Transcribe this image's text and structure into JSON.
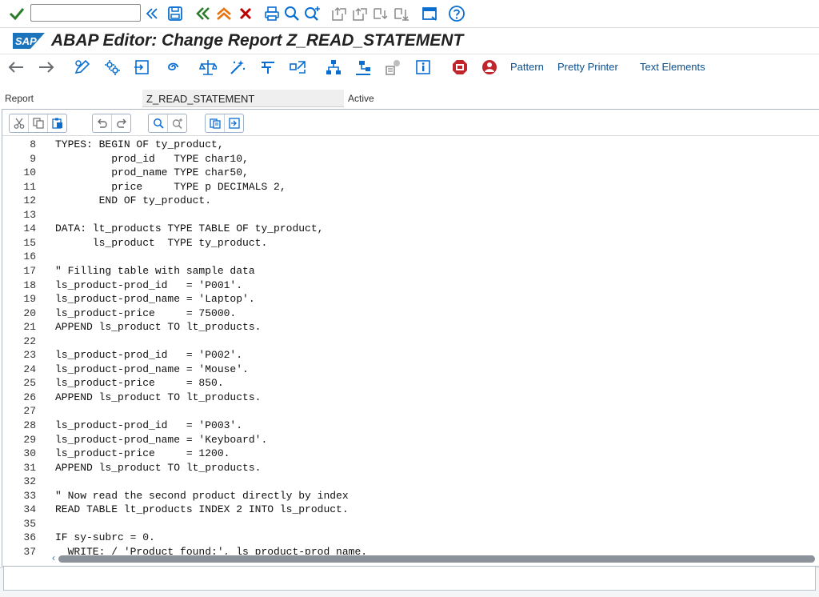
{
  "system_toolbar": {
    "command_field": {
      "value": "",
      "placeholder": ""
    },
    "icons": [
      "enter-check-icon",
      "expand-icon",
      "save-icon",
      "back-icon",
      "exit-icon",
      "cancel-icon",
      "print-icon",
      "find-icon",
      "find-next-icon",
      "first-page-icon",
      "previous-page-icon",
      "next-page-icon",
      "last-page-icon",
      "new-session-icon",
      "help-icon"
    ]
  },
  "title_bar": {
    "logo_text": "SAP",
    "title": "ABAP Editor: Change Report Z_READ_STATEMENT"
  },
  "app_toolbar": {
    "icons": [
      "back-arrow-icon",
      "forward-arrow-icon",
      "display-change-icon",
      "active-inactive-icon",
      "other-object-icon",
      "check-icon",
      "activate-icon",
      "test-icon",
      "where-used-icon",
      "navigation-icon",
      "hierarchy-icon",
      "display-object-list-icon",
      "breakpoint-icon",
      "info-icon",
      "set-breakpoint-icon",
      "stop-icon"
    ],
    "pattern_label": "Pattern",
    "pretty_printer_label": "Pretty Printer",
    "text_elements_label": "Text Elements"
  },
  "header": {
    "report_label": "Report",
    "report_name": "Z_READ_STATEMENT",
    "status": "Active"
  },
  "editor": {
    "scroll_left_glyph": "‹",
    "lines": [
      {
        "num": "8",
        "text": "TYPES: BEGIN OF ty_product,"
      },
      {
        "num": "9",
        "text": "         prod_id   TYPE char10,"
      },
      {
        "num": "10",
        "text": "         prod_name TYPE char50,"
      },
      {
        "num": "11",
        "text": "         price     TYPE p DECIMALS 2,"
      },
      {
        "num": "12",
        "text": "       END OF ty_product."
      },
      {
        "num": "13",
        "text": ""
      },
      {
        "num": "14",
        "text": "DATA: lt_products TYPE TABLE OF ty_product,"
      },
      {
        "num": "15",
        "text": "      ls_product  TYPE ty_product."
      },
      {
        "num": "16",
        "text": ""
      },
      {
        "num": "17",
        "text": "\" Filling table with sample data"
      },
      {
        "num": "18",
        "text": "ls_product-prod_id   = 'P001'."
      },
      {
        "num": "19",
        "text": "ls_product-prod_name = 'Laptop'."
      },
      {
        "num": "20",
        "text": "ls_product-price     = 75000."
      },
      {
        "num": "21",
        "text": "APPEND ls_product TO lt_products."
      },
      {
        "num": "22",
        "text": ""
      },
      {
        "num": "23",
        "text": "ls_product-prod_id   = 'P002'."
      },
      {
        "num": "24",
        "text": "ls_product-prod_name = 'Mouse'."
      },
      {
        "num": "25",
        "text": "ls_product-price     = 850."
      },
      {
        "num": "26",
        "text": "APPEND ls_product TO lt_products."
      },
      {
        "num": "27",
        "text": ""
      },
      {
        "num": "28",
        "text": "ls_product-prod_id   = 'P003'."
      },
      {
        "num": "29",
        "text": "ls_product-prod_name = 'Keyboard'."
      },
      {
        "num": "30",
        "text": "ls_product-price     = 1200."
      },
      {
        "num": "31",
        "text": "APPEND ls_product TO lt_products."
      },
      {
        "num": "32",
        "text": ""
      },
      {
        "num": "33",
        "text": "\" Now read the second product directly by index"
      },
      {
        "num": "34",
        "text": "READ TABLE lt_products INDEX 2 INTO ls_product."
      },
      {
        "num": "35",
        "text": ""
      },
      {
        "num": "36",
        "text": "IF sy-subrc = 0."
      },
      {
        "num": "37",
        "text": "  WRITE: / 'Product found:', ls_product-prod_name."
      }
    ]
  },
  "colors": {
    "icon_blue": "#0a6ed1",
    "confirm_green": "#2b7d2b",
    "cancel_red": "#bb0000",
    "sap_logo_blue": "#1c75bc",
    "stop_red": "#c0242c"
  }
}
